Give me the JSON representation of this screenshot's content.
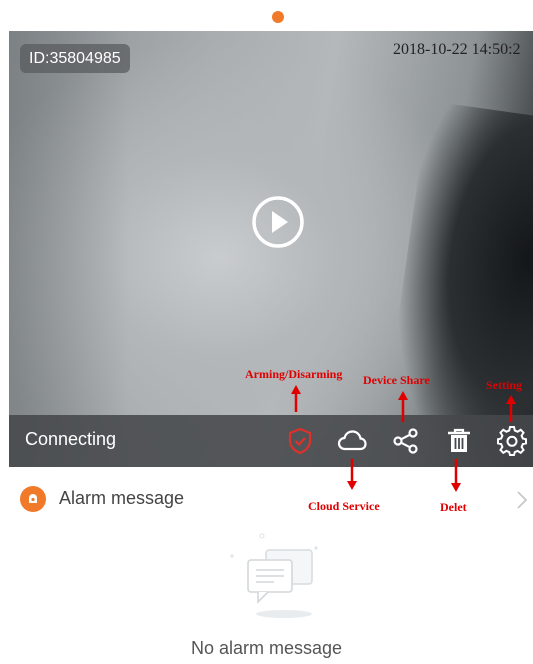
{
  "page_indicator": {
    "active_color": "#f07a2a"
  },
  "video": {
    "device_id": "ID:35804985",
    "timestamp": "2018-10-22  14:50:2",
    "play_icon": "play-circle-icon"
  },
  "control_bar": {
    "status": "Connecting",
    "buttons": [
      {
        "name": "arming-disarming",
        "icon": "shield-check-icon",
        "color": "#e0302a"
      },
      {
        "name": "cloud-service",
        "icon": "cloud-icon",
        "color": "#ffffff"
      },
      {
        "name": "device-share",
        "icon": "share-icon",
        "color": "#ffffff"
      },
      {
        "name": "delete",
        "icon": "trash-icon",
        "color": "#ffffff"
      },
      {
        "name": "setting",
        "icon": "gear-icon",
        "color": "#ffffff"
      }
    ]
  },
  "annotations": {
    "arming": "Arming/Disarming",
    "share": "Device Share",
    "setting": "Setting",
    "cloud": "Cloud Service",
    "delete": "Delet",
    "color": "#e00000"
  },
  "alarm": {
    "label": "Alarm message",
    "icon": "alarm-bell-icon",
    "chevron": "chevron-right-icon",
    "empty_text": "No alarm message",
    "empty_icon": "chat-bubbles-icon"
  }
}
